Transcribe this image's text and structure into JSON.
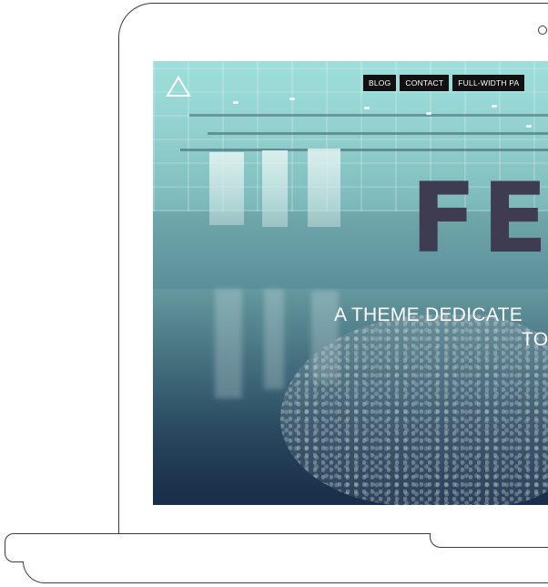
{
  "site": {
    "logo": "triangle-logo",
    "nav": {
      "items": [
        {
          "label": "BLOG"
        },
        {
          "label": "CONTACT"
        },
        {
          "label": "FULL-WIDTH PA"
        }
      ]
    },
    "hero": {
      "title": "FE",
      "subtitle_line1": "A THEME DEDICATE",
      "subtitle_line2": "TO"
    }
  },
  "colors": {
    "nav_bg": "#111111",
    "nav_text": "#ffffff",
    "title": "#3f3c52",
    "subtitle": "#ffffff",
    "laptop_outline": "#3a3a3a"
  }
}
